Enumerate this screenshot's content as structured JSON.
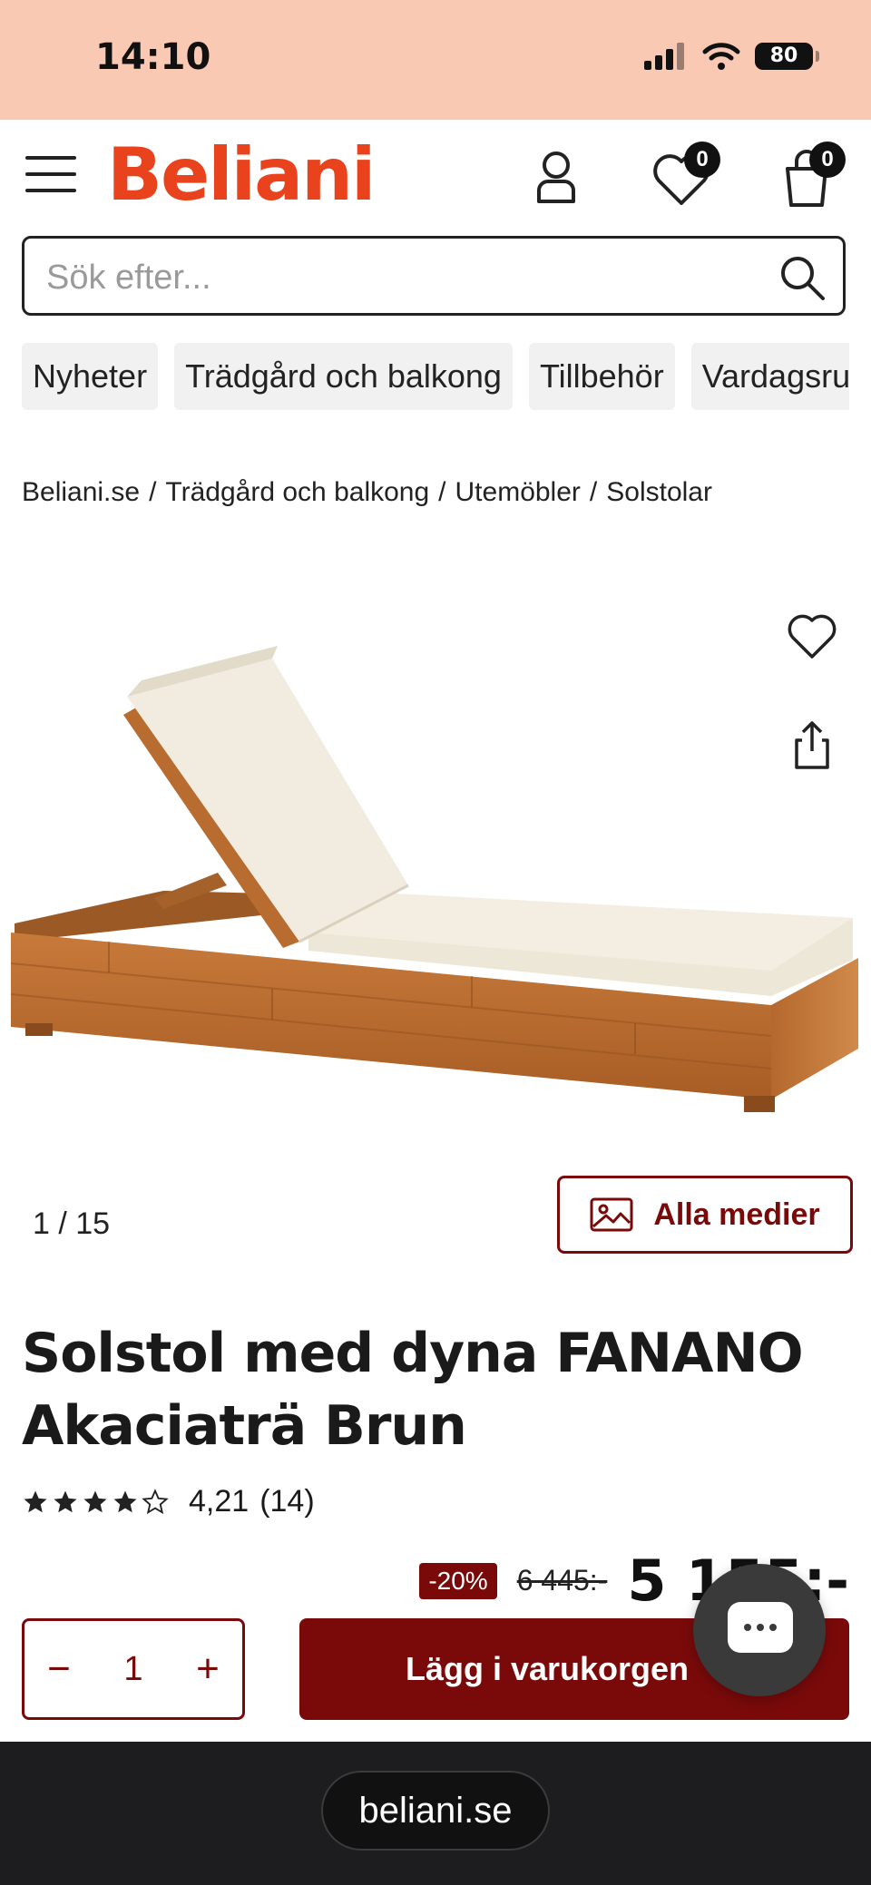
{
  "status_bar": {
    "time": "14:10",
    "battery": "80"
  },
  "header": {
    "logo": "Beliani",
    "wishlist_count": "0",
    "cart_count": "0"
  },
  "search": {
    "placeholder": "Sök efter..."
  },
  "categories": [
    "Nyheter",
    "Trädgård och balkong",
    "Tillbehör",
    "Vardagsrum"
  ],
  "breadcrumb": [
    "Beliani.se",
    "Trädgård och balkong",
    "Utemöbler",
    "Solstolar"
  ],
  "gallery": {
    "current": "1",
    "total": "15",
    "all_media_label": "Alla medier"
  },
  "product": {
    "title": "Solstol med dyna FANANO Akaciaträ Brun",
    "rating": "4,21",
    "review_count": "(14)",
    "stars_filled": 4,
    "stars_total": 5,
    "discount": "-20%",
    "old_price": "6 445:-",
    "new_price": "5 155:-"
  },
  "cart": {
    "quantity": "1",
    "add_label": "Lägg i varukorgen"
  },
  "browser": {
    "url": "beliani.se"
  },
  "colors": {
    "brand": "#e8431d",
    "accent": "#7a0a0a",
    "status_bar": "#f9c9b4"
  }
}
